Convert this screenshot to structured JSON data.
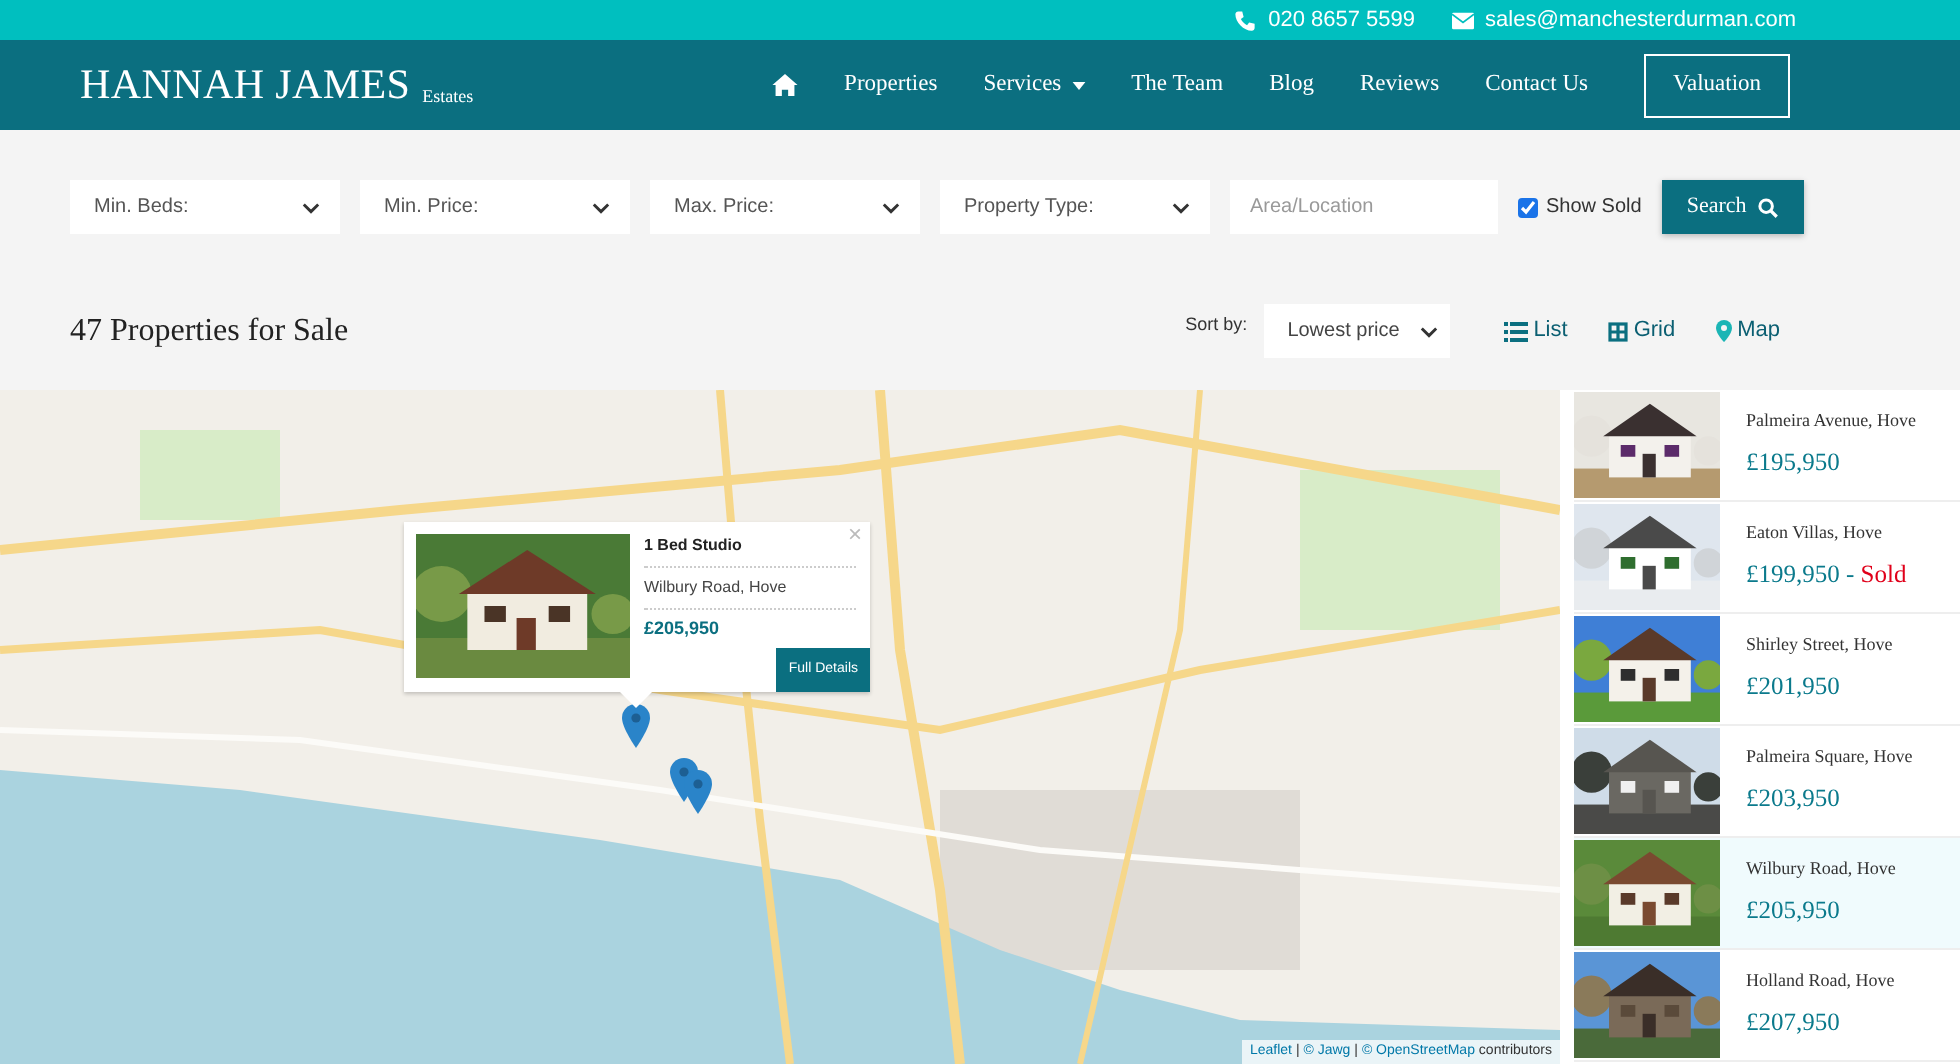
{
  "top_bar": {
    "phone": "020 8657 5599",
    "email": "sales@manchesterdurman.com"
  },
  "logo": {
    "name": "HANNAH JAMES",
    "suffix": "Estates"
  },
  "nav": {
    "items": [
      {
        "kind": "home"
      },
      {
        "kind": "link",
        "label": "Properties",
        "dropdown": false
      },
      {
        "kind": "link",
        "label": "Services",
        "dropdown": true
      },
      {
        "kind": "link",
        "label": "The Team",
        "dropdown": false
      },
      {
        "kind": "link",
        "label": "Blog",
        "dropdown": false
      },
      {
        "kind": "link",
        "label": "Reviews",
        "dropdown": false
      },
      {
        "kind": "link",
        "label": "Contact Us",
        "dropdown": false
      }
    ],
    "cta": "Valuation"
  },
  "filters": {
    "selects": [
      {
        "value": "Min. Beds:"
      },
      {
        "value": "Min. Price:"
      },
      {
        "value": "Max. Price:"
      },
      {
        "value": "Property Type:"
      }
    ],
    "location": {
      "placeholder": "Area/Location"
    },
    "show_sold": {
      "label": "Show Sold",
      "checked": true
    },
    "search_button": "Search"
  },
  "results": {
    "title": "47 Properties for Sale",
    "sort_label": "Sort by:",
    "sort_value": "Lowest price",
    "views": [
      {
        "kind": "list",
        "label": "List"
      },
      {
        "kind": "grid",
        "label": "Grid"
      },
      {
        "kind": "map",
        "label": "Map"
      }
    ]
  },
  "map_popup": {
    "title": "1 Bed Studio",
    "address": "Wilbury Road, Hove",
    "price": "£205,950",
    "button": "Full Details",
    "close": "×"
  },
  "map_attribution": [
    {
      "kind": "link",
      "text": "Leaflet"
    },
    {
      "kind": "sep",
      "text": "|"
    },
    {
      "kind": "link",
      "text": "© Jawg"
    },
    {
      "kind": "sep",
      "text": "|"
    },
    {
      "kind": "link",
      "text": "© OpenStreetMap"
    },
    {
      "kind": "text",
      "text": "contributors"
    }
  ],
  "listings": [
    {
      "address": "Palmeira Avenue, Hove",
      "price": "£195,950",
      "selected": false
    },
    {
      "address": "Eaton Villas, Hove",
      "price": "£199,950",
      "status": {
        "separator": "-",
        "label": "Sold"
      },
      "selected": false
    },
    {
      "address": "Shirley Street, Hove",
      "price": "£201,950",
      "selected": false
    },
    {
      "address": "Palmeira Square, Hove",
      "price": "£203,950",
      "selected": false
    },
    {
      "address": "Wilbury Road, Hove",
      "price": "£205,950",
      "selected": true
    },
    {
      "address": "Holland Road, Hove",
      "price": "£207,950",
      "selected": false
    }
  ]
}
